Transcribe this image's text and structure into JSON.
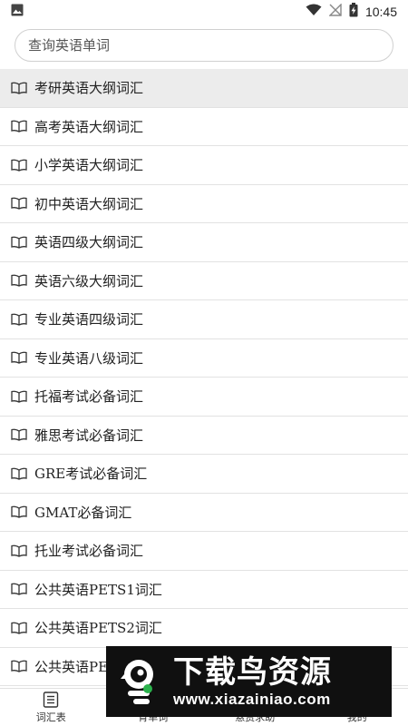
{
  "status_bar": {
    "time": "10:45",
    "icons": [
      "image-icon",
      "wifi-icon",
      "no-signal-icon",
      "battery-charging-icon"
    ]
  },
  "search": {
    "placeholder": "查询英语单词"
  },
  "vocab_list": [
    {
      "label": "考研英语大纲词汇",
      "active": true
    },
    {
      "label": "高考英语大纲词汇"
    },
    {
      "label": "小学英语大纲词汇"
    },
    {
      "label": "初中英语大纲词汇"
    },
    {
      "label": "英语四级大纲词汇"
    },
    {
      "label": "英语六级大纲词汇"
    },
    {
      "label": "专业英语四级词汇"
    },
    {
      "label": "专业英语八级词汇"
    },
    {
      "label": "托福考试必备词汇"
    },
    {
      "label": "雅思考试必备词汇"
    },
    {
      "label": "GRE考试必备词汇"
    },
    {
      "label": "GMAT必备词汇"
    },
    {
      "label": "托业考试必备词汇"
    },
    {
      "label": "公共英语PETS1词汇"
    },
    {
      "label": "公共英语PETS2词汇"
    },
    {
      "label": "公共英语PE"
    }
  ],
  "bottom_nav": {
    "tabs": [
      {
        "label": "词汇表",
        "icon": "list-icon"
      },
      {
        "label": "背单词",
        "icon": "cards-icon"
      },
      {
        "label": "悬赏求助",
        "icon": "reward-icon"
      },
      {
        "label": "我的",
        "icon": "user-icon"
      }
    ]
  },
  "watermark": {
    "title": "下载鸟资源",
    "url": "www.xiazainiao.com"
  }
}
